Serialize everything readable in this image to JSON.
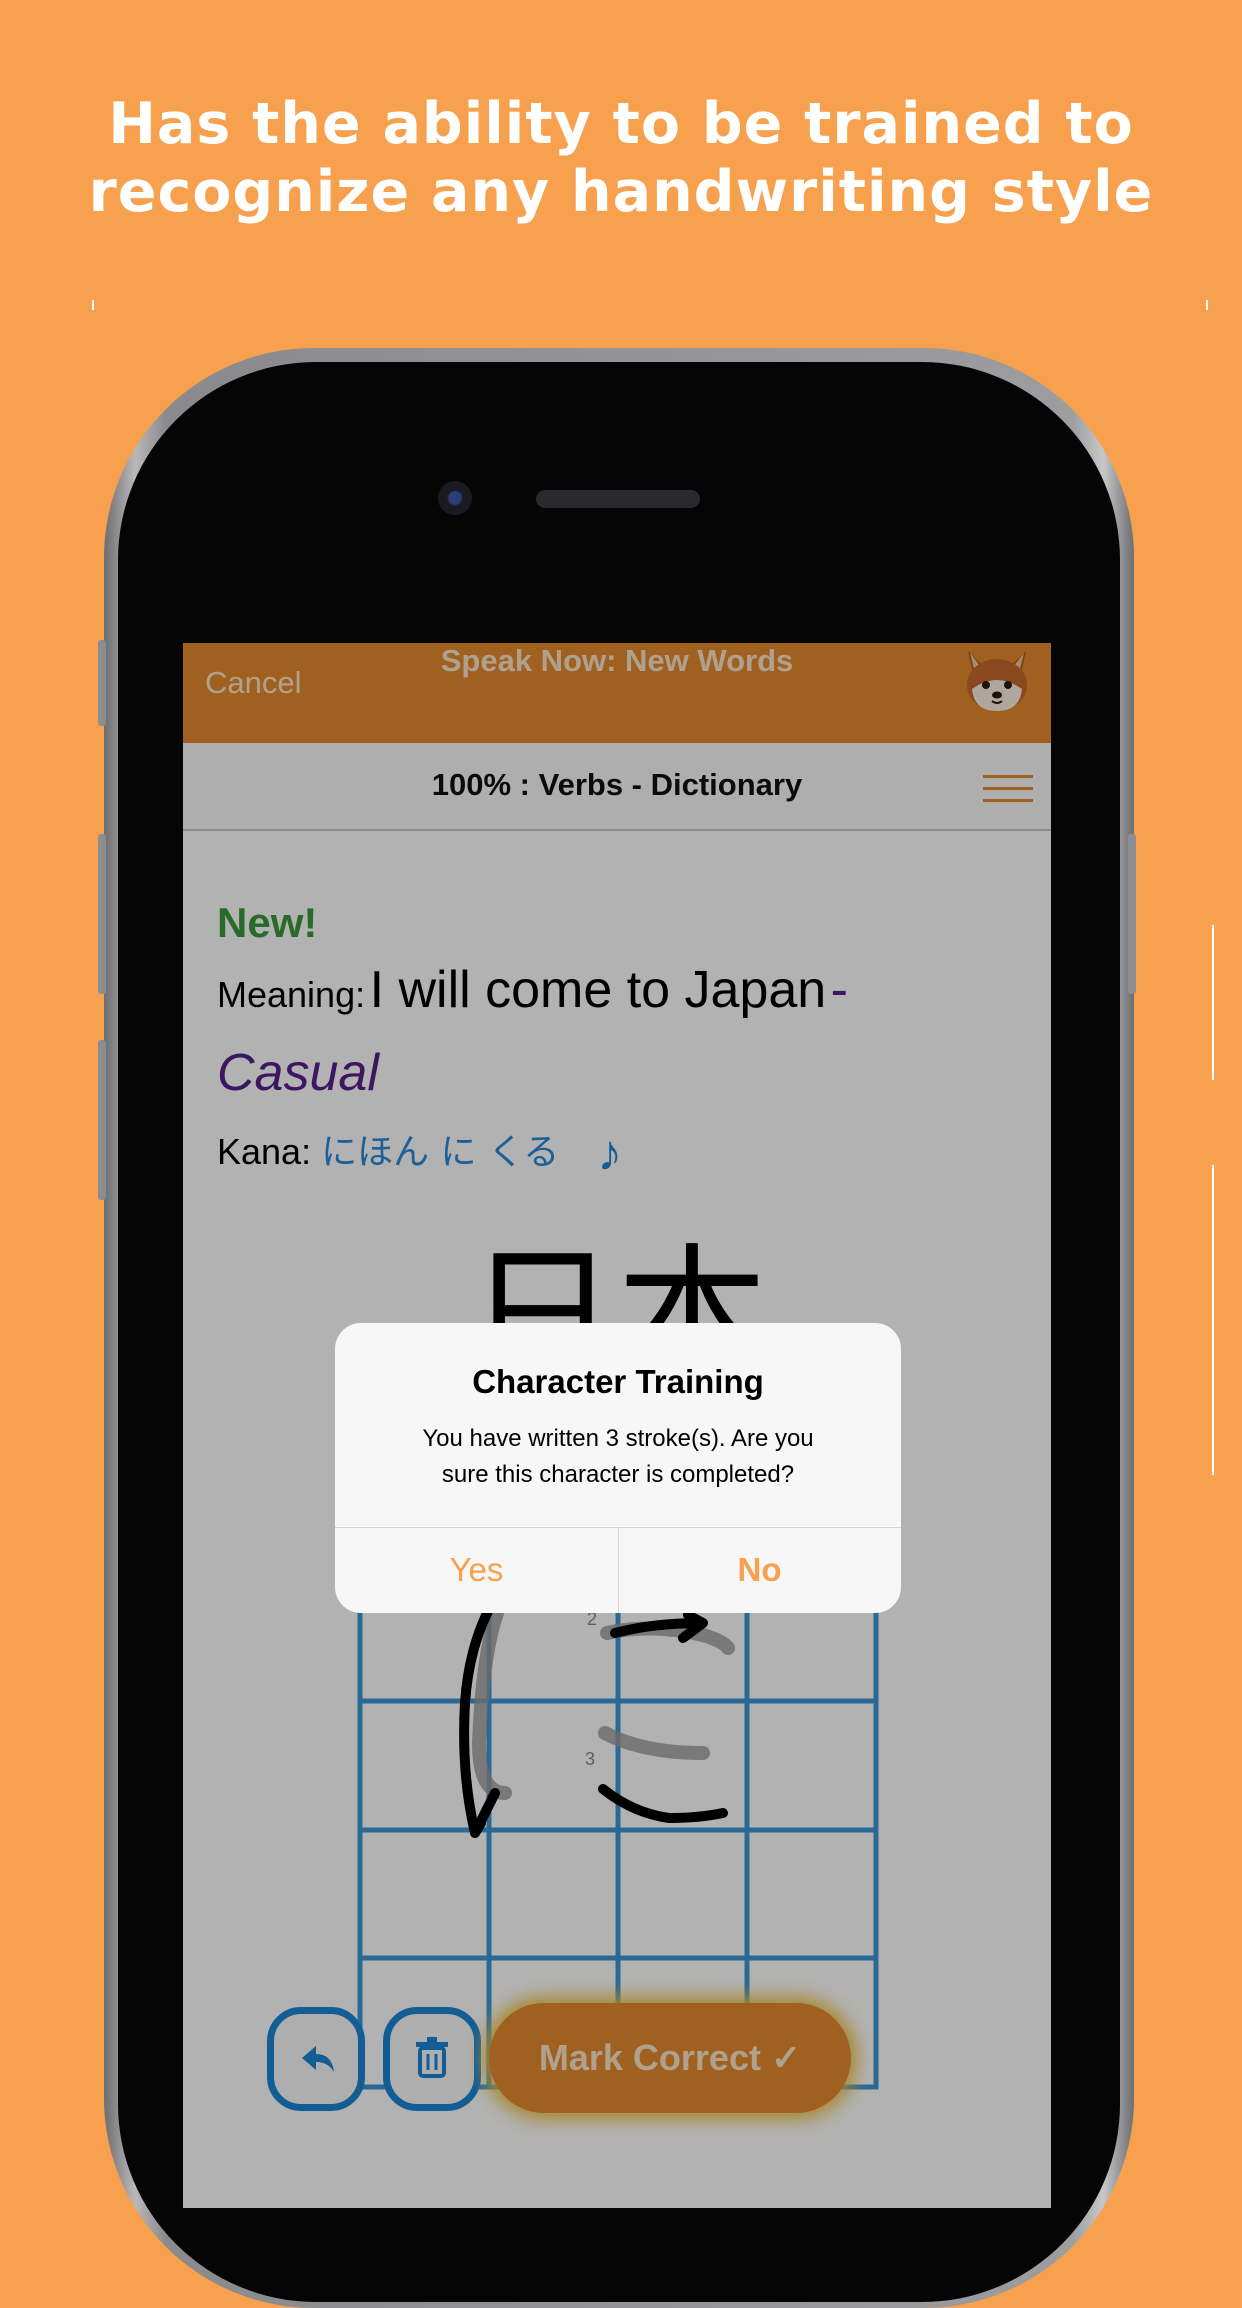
{
  "promo": {
    "line1": "Has the ability to be trained to",
    "line2": "recognize any handwriting style"
  },
  "app": {
    "nav": {
      "cancel_label": "Cancel",
      "title": "Speak Now: New Words"
    },
    "subheader": {
      "title": "100% : Verbs - Dictionary"
    },
    "card": {
      "new_label": "New!",
      "meaning_key": "Meaning:",
      "meaning_value": "I will come to Japan",
      "register_sep": " - ",
      "register": "Casual",
      "kana_key": "Kana:",
      "kana_value": "にほん に くる",
      "audio_icon": "music-note-icon",
      "kanji": "日本"
    },
    "canvas": {
      "stroke_numbers": [
        "2",
        "3"
      ]
    },
    "actions": {
      "undo_icon": "undo-icon",
      "delete_icon": "trash-icon",
      "mark_correct_label": "Mark Correct ✓"
    },
    "dialog": {
      "title": "Character Training",
      "message_line1": "You have written 3 stroke(s). Are you",
      "message_line2": "sure this character is completed?",
      "yes_label": "Yes",
      "no_label": "No"
    }
  },
  "colors": {
    "background": "#F7A04D",
    "nav_bar": "#E58B2E",
    "accent_blue": "#1a86d4",
    "new_green": "#3a9a3a",
    "register_purple": "#5a1f8c"
  }
}
